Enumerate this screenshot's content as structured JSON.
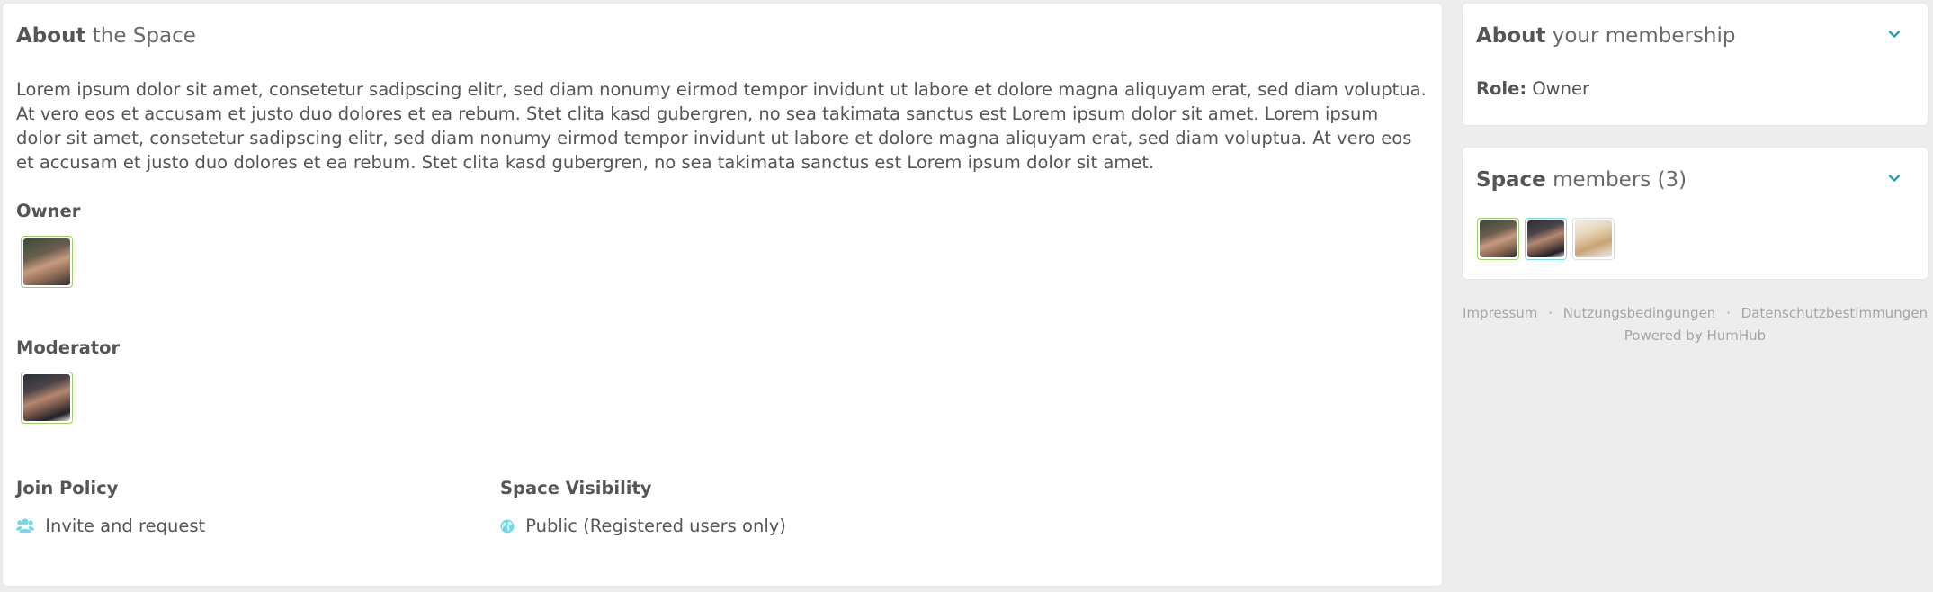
{
  "about_space": {
    "title_strong": "About",
    "title_light": "the Space",
    "description": "Lorem ipsum dolor sit amet, consetetur sadipscing elitr, sed diam nonumy eirmod tempor invidunt ut labore et dolore magna aliquyam erat, sed diam voluptua. At vero eos et accusam et justo duo dolores et ea rebum. Stet clita kasd gubergren, no sea takimata sanctus est Lorem ipsum dolor sit amet. Lorem ipsum dolor sit amet, consetetur sadipscing elitr, sed diam nonumy eirmod tempor invidunt ut labore et dolore magna aliquyam erat, sed diam voluptua. At vero eos et accusam et justo duo dolores et ea rebum. Stet clita kasd gubergren, no sea takimata sanctus est Lorem ipsum dolor sit amet.",
    "owner_label": "Owner",
    "moderator_label": "Moderator",
    "join_policy_label": "Join Policy",
    "join_policy_value": "Invite and request",
    "join_policy_icon": "users-icon",
    "visibility_label": "Space Visibility",
    "visibility_value": "Public (Registered users only)",
    "visibility_icon": "globe-icon"
  },
  "membership": {
    "title_strong": "About",
    "title_light": "your membership",
    "role_label": "Role:",
    "role_value": "Owner"
  },
  "members": {
    "title_strong": "Space",
    "title_light": "members (3)"
  },
  "footer": {
    "links": [
      "Impressum",
      "Nutzungsbedingungen",
      "Datenschutzbestimmungen"
    ],
    "separator": "·",
    "powered_prefix": "Powered by",
    "powered_brand": "HumHub"
  },
  "colors": {
    "accent": "#21a1b3",
    "icon_teal": "#6fdbe8",
    "avatar_border_green": "#9bcf6a",
    "background": "#ededed",
    "text": "#555555"
  }
}
